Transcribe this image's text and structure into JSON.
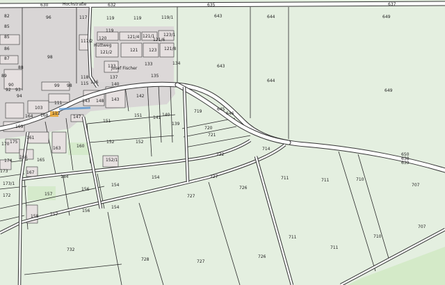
{
  "colors": {
    "land": "#e4efe0",
    "built_area": "#d9d6d6",
    "building": "#e6e0e0",
    "road": "#ffffff",
    "road_outline": "#333333",
    "water_label": "#4a8fd0",
    "highlight": "#e8a020",
    "green_patch": "#cfe8c2"
  },
  "map": {
    "street_labels": [
      "Hochstraße",
      "Hüttweg"
    ],
    "place_labels": [
      "Josef Fischer"
    ],
    "parcels": {
      "p82": "82",
      "p85": "85",
      "p85b": "85",
      "p86": "86",
      "p87": "87",
      "p88": "88",
      "p89": "89",
      "p90": "90",
      "p92": "92",
      "p93": "93",
      "p94": "94",
      "p96": "96",
      "p98": "98",
      "p98b": "98",
      "p99": "99",
      "p103": "103",
      "p111": "111",
      "p112": "112",
      "p115": "115",
      "p116": "116",
      "p117": "117",
      "p117b": "117/2",
      "p118": "118",
      "p119": "119",
      "p119b": "119",
      "p119c": "119",
      "p119_1": "119/1",
      "p120": "120",
      "p121": "121",
      "p121_1": "121/1",
      "p121_2": "121/2",
      "p121_4": "121/4",
      "p121_6": "121/6",
      "p121_8": "121/8",
      "p123": "123",
      "p123_1": "123/1",
      "p133": "133",
      "p133b": "133",
      "p134": "134",
      "p135": "135",
      "p137": "137",
      "p139": "139",
      "p140": "140",
      "p140b": "140",
      "p141": "141",
      "p142": "142",
      "p143": "143",
      "p143b": "143",
      "p147": "147",
      "p148": "148",
      "p151": "151",
      "p151b": "151",
      "p152": "152",
      "p152b": "152",
      "p152_1": "152/1",
      "p154": "154",
      "p154b": "154",
      "p154c": "154",
      "p156": "156",
      "p156b": "156",
      "p157": "157",
      "p157b": "157",
      "p158": "158",
      "p160": "160",
      "p161": "161",
      "p163": "163",
      "p164": "164",
      "p165": "165",
      "p166": "166",
      "p167": "167",
      "p168": "168",
      "p170": "170",
      "p172": "172",
      "p173": "173",
      "p173_1": "173/1",
      "p174": "174",
      "p175": "175",
      "p184": "184",
      "p169": "169",
      "p630": "630",
      "p632": "632",
      "p633": "633",
      "p635": "635",
      "p637": "637",
      "p643": "643",
      "p643b": "643",
      "p644": "644",
      "p644b": "644",
      "p645": "645",
      "p646": "646",
      "p649": "649",
      "p649b": "649",
      "p650": "650",
      "p707": "707",
      "p707b": "707",
      "p710": "710",
      "p710b": "710",
      "p711": "711",
      "p711b": "711",
      "p711c": "711",
      "p711d": "711",
      "p714": "714",
      "p719": "719",
      "p720": "720",
      "p721": "721",
      "p722": "722",
      "p726": "726",
      "p726b": "726",
      "p727": "727",
      "p727b": "727",
      "p728": "728",
      "p732": "732",
      "p638": "638",
      "p639": "639",
      "p727c": "727"
    }
  }
}
